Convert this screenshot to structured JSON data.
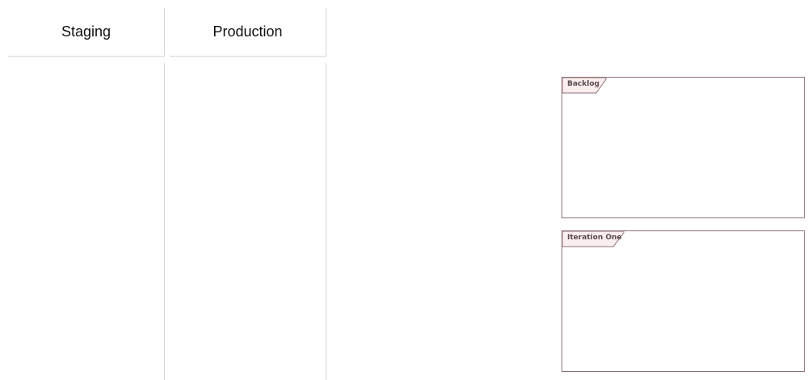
{
  "lanes": [
    {
      "title": "Staging"
    },
    {
      "title": "Production"
    }
  ],
  "frames": [
    {
      "label": "Backlog"
    },
    {
      "label": "Iteration One"
    }
  ],
  "colors": {
    "frame_border": "#8f7278",
    "frame_tab_fill": "#fbeeee",
    "lane_divider": "#d6d6d6"
  }
}
